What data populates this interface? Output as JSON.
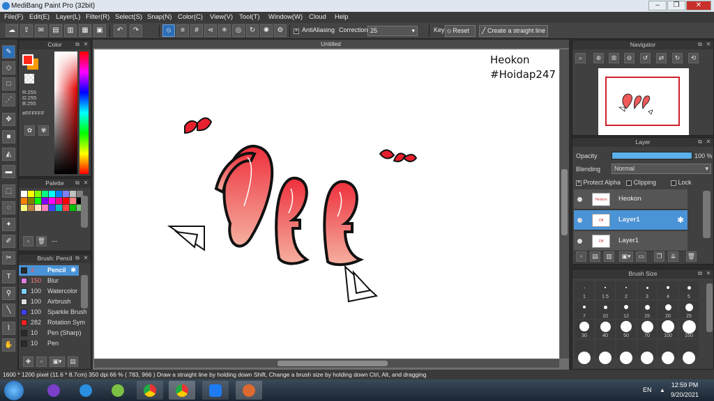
{
  "window": {
    "title": "MediBang Paint Pro (32bit)",
    "minimize": "–",
    "restore": "❐",
    "close": "✕"
  },
  "menu": [
    "File(F)",
    "Edit(E)",
    "Layer(L)",
    "Filter(R)",
    "Select(S)",
    "Snap(N)",
    "Color(C)",
    "View(V)",
    "Tool(T)",
    "Window(W)",
    "Cloud",
    "Help"
  ],
  "toolbar": {
    "antialiasing_label": "AntiAliasing",
    "correction_label": "Correction",
    "correction_value": "25",
    "key_label": "Key",
    "reset_label": "Reset",
    "straight_line_label": "Create a straight line"
  },
  "color_panel": {
    "title": "Color",
    "r": "R:255",
    "g": "G:255",
    "b": "B:255",
    "hex": "#FFFFFF",
    "primary_color": "#ff2a1a",
    "secondary_color": "#ff9a00"
  },
  "palette_panel": {
    "title": "Palette",
    "extra": "---",
    "swatches": [
      "#ffffff",
      "#ffff00",
      "#80ff00",
      "#00ff80",
      "#00ffff",
      "#0080ff",
      "#8080ff",
      "#c0c0c0",
      "#808080",
      "#ff8000",
      "#808000",
      "#00ff00",
      "#8000ff",
      "#ff00ff",
      "#ff0080",
      "#ff0000",
      "#ff8080",
      "#000000",
      "#ffff80",
      "#c08040",
      "#ffe0c0",
      "#ff80c0",
      "#4040ff",
      "#00c0c0",
      "#ff4040",
      "#00c000",
      "#80c080"
    ]
  },
  "brush_panel": {
    "title": "Brush: Pencil",
    "items": [
      {
        "size": "4",
        "name": "Pencil",
        "color": "#2a2a2a"
      },
      {
        "size": "150",
        "name": "Blur",
        "color": "#e080e0"
      },
      {
        "size": "100",
        "name": "Watercolor",
        "color": "#80d0ff"
      },
      {
        "size": "100",
        "name": "Airbrush",
        "color": "#e0e0e0"
      },
      {
        "size": "100",
        "name": "Sparkle Brush",
        "color": "#4040ff"
      },
      {
        "size": "282",
        "name": "Rotation Sym",
        "color": "#ff2020"
      },
      {
        "size": "10",
        "name": "Pen (Sharp)",
        "color": "#2a2a2a"
      },
      {
        "size": "10",
        "name": "Pen",
        "color": "#2a2a2a"
      }
    ]
  },
  "canvas": {
    "tab_title": "Untitled",
    "watermark_line1": "Heokon",
    "watermark_line2": "#Hoidap247",
    "lettering": "Off"
  },
  "navigator": {
    "title": "Navigator"
  },
  "layer_panel": {
    "title": "Layer",
    "opacity_label": "Opacity",
    "opacity_value": "100 %",
    "opacity_fraction": 1.0,
    "blending_label": "Blending",
    "blending_value": "Normal",
    "protect_alpha": "Protect Alpha",
    "clipping": "Clipping",
    "lock": "Lock",
    "layers": [
      {
        "name": "Heokon",
        "selected": false,
        "thumb": "Heokon #Hoidap247"
      },
      {
        "name": "Layer1",
        "selected": true,
        "thumb": "Off"
      },
      {
        "name": "Layer1",
        "selected": false,
        "thumb": "Off"
      }
    ]
  },
  "brush_size_panel": {
    "title": "Brush Size",
    "sizes": [
      "1",
      "1.5",
      "2",
      "3",
      "4",
      "5",
      "7",
      "10",
      "12",
      "15",
      "20",
      "25",
      "30",
      "40",
      "50",
      "70",
      "100",
      "150"
    ]
  },
  "status": "1600 * 1200 pixel   (11.6 * 8.7cm)   350 dpi   66 %   ( 783, 966 )   Draw a straight line by holding down Shift, Change a brush size by holding down Ctrl, Alt, and dragging",
  "taskbar": {
    "lang": "EN",
    "time": "12:59 PM",
    "date": "9/20/2021"
  }
}
